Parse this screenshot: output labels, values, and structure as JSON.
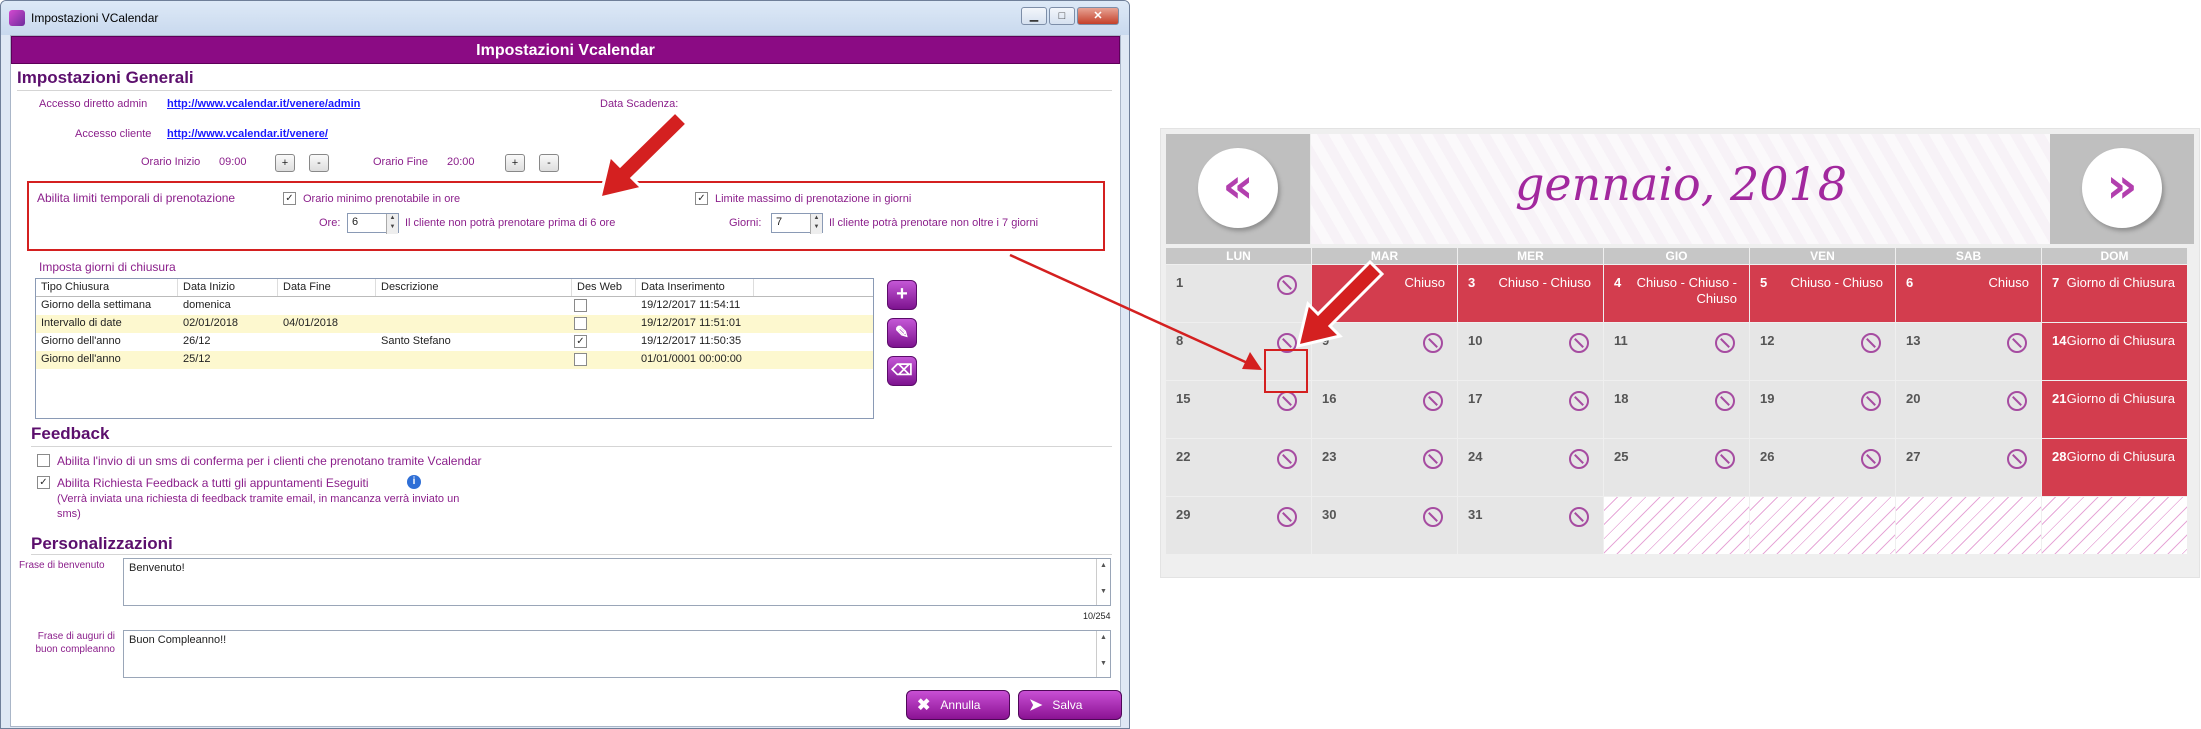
{
  "window": {
    "title": "Impostazioni VCalendar",
    "minimize": "▁",
    "maximize": "□",
    "close": "✕"
  },
  "banner": "Impostazioni Vcalendar",
  "general": {
    "title": "Impostazioni Generali",
    "admin_label": "Accesso diretto admin",
    "admin_url": "http://www.vcalendar.it/venere/admin",
    "client_label": "Accesso cliente",
    "client_url": "http://www.vcalendar.it/venere/",
    "expiry_label": "Data Scadenza:",
    "start_label": "Orario Inizio",
    "start_value": "09:00",
    "end_label": "Orario Fine",
    "end_value": "20:00",
    "plus": "+",
    "minus": "-"
  },
  "limits": {
    "label": "Abilita limiti temporali di prenotazione",
    "min_check": "Orario minimo prenotabile in ore",
    "min_checked": "✓",
    "min_field_label": "Ore:",
    "min_value": "6",
    "min_note": "Il cliente non potrà prenotare prima di 6 ore",
    "max_check": "Limite massimo di prenotazione in giorni",
    "max_checked": "✓",
    "max_field_label": "Giorni:",
    "max_value": "7",
    "max_note": "Il cliente potrà prenotare non oltre i 7 giorni",
    "up": "▲",
    "down": "▼"
  },
  "closures": {
    "title": "Imposta giorni di chiusura",
    "headers": [
      "Tipo Chiusura",
      "Data Inizio",
      "Data Fine",
      "Descrizione",
      "Des Web",
      "Data Inserimento"
    ],
    "rows": [
      {
        "tipo": "Giorno della settimana",
        "inizio": "domenica",
        "fine": "",
        "descr": "",
        "web": "",
        "ins": "19/12/2017 11:54:11"
      },
      {
        "tipo": "Intervallo di date",
        "inizio": "02/01/2018",
        "fine": "04/01/2018",
        "descr": "",
        "web": "",
        "ins": "19/12/2017 11:51:01"
      },
      {
        "tipo": "Giorno dell'anno",
        "inizio": "26/12",
        "fine": "",
        "descr": "Santo Stefano",
        "web": "✓",
        "ins": "19/12/2017 11:50:35"
      },
      {
        "tipo": "Giorno dell'anno",
        "inizio": "25/12",
        "fine": "",
        "descr": "",
        "web": "",
        "ins": "01/01/0001 00:00:00"
      }
    ],
    "add_icon": "+",
    "edit_icon": "✎",
    "delete_icon": "⌫"
  },
  "feedback": {
    "title": "Feedback",
    "sms_label": "Abilita l'invio di un sms di conferma per i clienti che prenotano tramite Vcalendar",
    "req_label": "Abilita Richiesta Feedback a tutti gli appuntamenti Eseguiti",
    "req_checked": "✓",
    "req_note": "(Verrà inviata una richiesta di feedback tramite email, in mancanza verrà inviato un sms)",
    "info_icon": "i"
  },
  "custom": {
    "title": "Personalizzazioni",
    "welcome_label": "Frase di benvenuto",
    "welcome_value": "Benvenuto!",
    "welcome_count": "10/254",
    "bday_label": "Frase di auguri di buon compleanno",
    "bday_value": "Buon Compleanno!!"
  },
  "actions": {
    "cancel": "Annulla",
    "save": "Salva",
    "cancel_icon": "✖",
    "save_icon": "➤"
  },
  "calendar": {
    "month": "gennaio, 2018",
    "prev": "«",
    "next": "»",
    "days": [
      "LUN",
      "MAR",
      "MER",
      "GIO",
      "VEN",
      "SAB",
      "DOM"
    ],
    "cells": [
      {
        "n": "1",
        "t": "",
        "s": "available"
      },
      {
        "n": "",
        "t": "Chiuso",
        "s": "closed"
      },
      {
        "n": "3",
        "t": "Chiuso - Chiuso",
        "s": "closed"
      },
      {
        "n": "4",
        "t": "Chiuso - Chiuso - Chiuso",
        "s": "closed"
      },
      {
        "n": "5",
        "t": "Chiuso - Chiuso",
        "s": "closed"
      },
      {
        "n": "6",
        "t": "Chiuso",
        "s": "closed"
      },
      {
        "n": "7",
        "t": "Giorno di Chiusura",
        "s": "closed"
      },
      {
        "n": "8",
        "t": "",
        "s": "available"
      },
      {
        "n": "9",
        "t": "",
        "s": "available"
      },
      {
        "n": "10",
        "t": "",
        "s": "available"
      },
      {
        "n": "11",
        "t": "",
        "s": "available"
      },
      {
        "n": "12",
        "t": "",
        "s": "available"
      },
      {
        "n": "13",
        "t": "",
        "s": "available"
      },
      {
        "n": "14",
        "t": "Giorno di Chiusura",
        "s": "closed"
      },
      {
        "n": "15",
        "t": "",
        "s": "available"
      },
      {
        "n": "16",
        "t": "",
        "s": "available"
      },
      {
        "n": "17",
        "t": "",
        "s": "available"
      },
      {
        "n": "18",
        "t": "",
        "s": "available"
      },
      {
        "n": "19",
        "t": "",
        "s": "available"
      },
      {
        "n": "20",
        "t": "",
        "s": "available"
      },
      {
        "n": "21",
        "t": "Giorno di Chiusura",
        "s": "closed"
      },
      {
        "n": "22",
        "t": "",
        "s": "available"
      },
      {
        "n": "23",
        "t": "",
        "s": "available"
      },
      {
        "n": "24",
        "t": "",
        "s": "available"
      },
      {
        "n": "25",
        "t": "",
        "s": "available"
      },
      {
        "n": "26",
        "t": "",
        "s": "available"
      },
      {
        "n": "27",
        "t": "",
        "s": "available"
      },
      {
        "n": "28",
        "t": "Giorno di Chiusura",
        "s": "closed"
      },
      {
        "n": "29",
        "t": "",
        "s": "available"
      },
      {
        "n": "30",
        "t": "",
        "s": "available"
      },
      {
        "n": "31",
        "t": "",
        "s": "available"
      },
      {
        "n": "",
        "t": "",
        "s": "empty"
      },
      {
        "n": "",
        "t": "",
        "s": "empty"
      },
      {
        "n": "",
        "t": "",
        "s": "empty"
      },
      {
        "n": "",
        "t": "",
        "s": "empty"
      }
    ]
  },
  "colors": {
    "accent": "#8b0b84",
    "closed": "#d33d4e",
    "highlight": "#d42020"
  }
}
